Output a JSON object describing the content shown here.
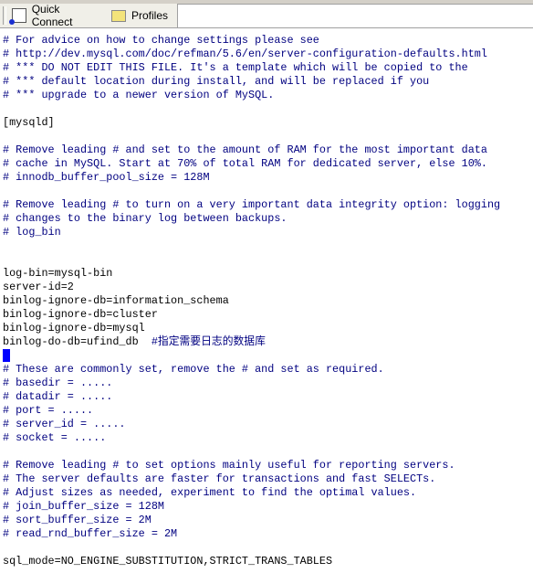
{
  "toolbar": {
    "quick_connect": "Quick Connect",
    "profiles": "Profiles"
  },
  "lines": [
    {
      "t": "# For advice on how to change settings please see",
      "c": "comment"
    },
    {
      "t": "# http://dev.mysql.com/doc/refman/5.6/en/server-configuration-defaults.html",
      "c": "comment"
    },
    {
      "t": "# *** DO NOT EDIT THIS FILE. It's a template which will be copied to the",
      "c": "comment"
    },
    {
      "t": "# *** default location during install, and will be replaced if you",
      "c": "comment"
    },
    {
      "t": "# *** upgrade to a newer version of MySQL.",
      "c": "comment"
    },
    {
      "t": "",
      "c": "code"
    },
    {
      "t": "[mysqld]",
      "c": "code"
    },
    {
      "t": "",
      "c": "code"
    },
    {
      "t": "# Remove leading # and set to the amount of RAM for the most important data",
      "c": "comment"
    },
    {
      "t": "# cache in MySQL. Start at 70% of total RAM for dedicated server, else 10%.",
      "c": "comment"
    },
    {
      "t": "# innodb_buffer_pool_size = 128M",
      "c": "comment"
    },
    {
      "t": "",
      "c": "code"
    },
    {
      "t": "# Remove leading # to turn on a very important data integrity option: logging",
      "c": "comment"
    },
    {
      "t": "# changes to the binary log between backups.",
      "c": "comment"
    },
    {
      "t": "# log_bin",
      "c": "comment"
    },
    {
      "t": "",
      "c": "code"
    },
    {
      "t": "",
      "c": "code"
    },
    {
      "t": "log-bin=mysql-bin",
      "c": "code"
    },
    {
      "t": "server-id=2",
      "c": "code"
    },
    {
      "t": "binlog-ignore-db=information_schema",
      "c": "code"
    },
    {
      "t": "binlog-ignore-db=cluster",
      "c": "code"
    },
    {
      "t": "binlog-ignore-db=mysql",
      "c": "code"
    },
    {
      "t": "binlog-do-db=ufind_db  ",
      "c": "code",
      "comment": "#指定需要日志的数据库"
    },
    {
      "t": "",
      "c": "cursor"
    },
    {
      "t": "# These are commonly set, remove the # and set as required.",
      "c": "comment"
    },
    {
      "t": "# basedir = .....",
      "c": "comment"
    },
    {
      "t": "# datadir = .....",
      "c": "comment"
    },
    {
      "t": "# port = .....",
      "c": "comment"
    },
    {
      "t": "# server_id = .....",
      "c": "comment"
    },
    {
      "t": "# socket = .....",
      "c": "comment"
    },
    {
      "t": "",
      "c": "code"
    },
    {
      "t": "# Remove leading # to set options mainly useful for reporting servers.",
      "c": "comment"
    },
    {
      "t": "# The server defaults are faster for transactions and fast SELECTs.",
      "c": "comment"
    },
    {
      "t": "# Adjust sizes as needed, experiment to find the optimal values.",
      "c": "comment"
    },
    {
      "t": "# join_buffer_size = 128M",
      "c": "comment"
    },
    {
      "t": "# sort_buffer_size = 2M",
      "c": "comment"
    },
    {
      "t": "# read_rnd_buffer_size = 2M",
      "c": "comment"
    },
    {
      "t": "",
      "c": "code"
    },
    {
      "t": "sql_mode=NO_ENGINE_SUBSTITUTION,STRICT_TRANS_TABLES",
      "c": "code"
    }
  ]
}
